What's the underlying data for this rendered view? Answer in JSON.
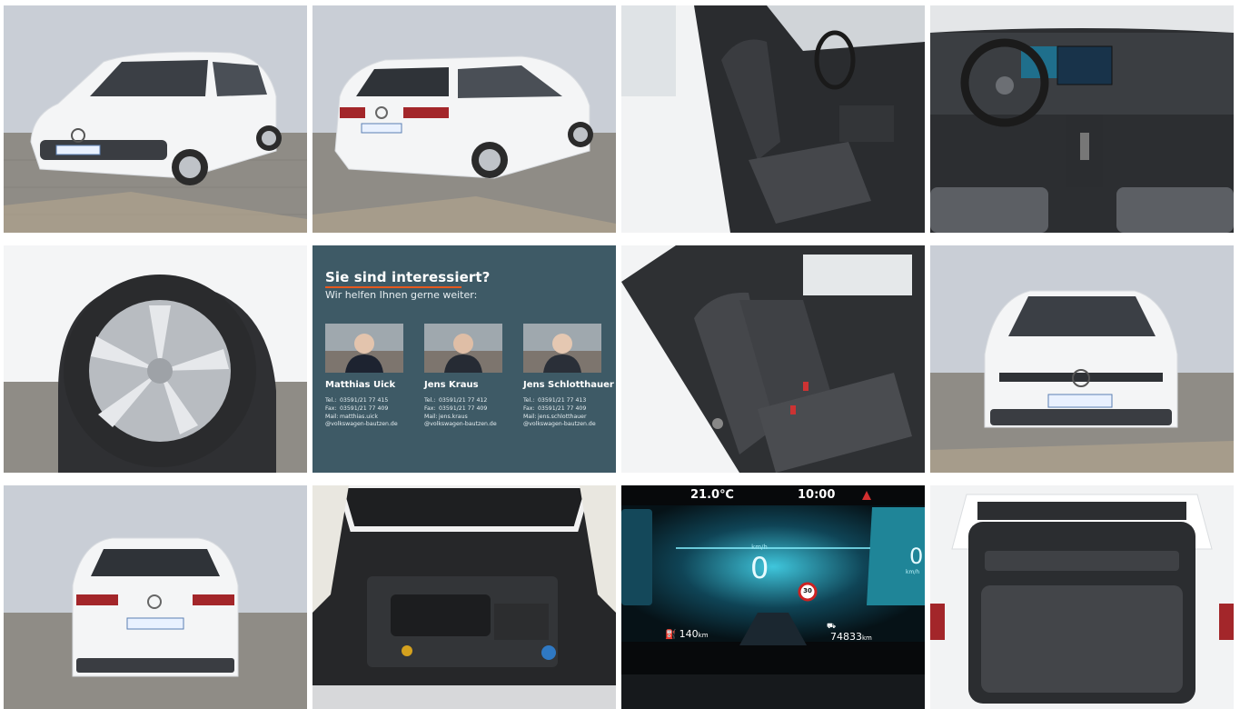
{
  "gallery": {
    "tiles": [
      {
        "id": "front-three-quarter"
      },
      {
        "id": "rear-three-quarter"
      },
      {
        "id": "driver-seat"
      },
      {
        "id": "dashboard-interior"
      },
      {
        "id": "wheel-rim"
      },
      {
        "id": "contact-card"
      },
      {
        "id": "rear-seats"
      },
      {
        "id": "front-view"
      },
      {
        "id": "rear-view"
      },
      {
        "id": "engine-bay"
      },
      {
        "id": "digital-cockpit"
      },
      {
        "id": "trunk"
      }
    ]
  },
  "contact_card": {
    "heading": "Sie sind interessiert?",
    "subheading": "Wir helfen Ihnen gerne weiter:",
    "persons": [
      {
        "name": "Matthias Uick",
        "tel_label": "Tel.:",
        "tel": "03591/21 77 415",
        "fax_label": "Fax:",
        "fax": "03591/21 77 409",
        "mail_label": "Mail:",
        "mail": "matthias.uick",
        "domain": "@volkswagen-bautzen.de"
      },
      {
        "name": "Jens Kraus",
        "tel_label": "Tel.:",
        "tel": "03591/21 77 412",
        "fax_label": "Fax:",
        "fax": "03591/21 77 409",
        "mail_label": "Mail:",
        "mail": "jens.kraus",
        "domain": "@volkswagen-bautzen.de"
      },
      {
        "name": "Jens Schlotthauer",
        "tel_label": "Tel.:",
        "tel": "03591/21 77 413",
        "fax_label": "Fax:",
        "fax": "03591/21 77 409",
        "mail_label": "Mail:",
        "mail": "jens.schlotthauer",
        "domain": "@volkswagen-bautzen.de"
      }
    ]
  },
  "cockpit": {
    "temperature": "21.0℃",
    "time": "10:00",
    "speed": "0",
    "speed_right": "0",
    "speed_unit": "km/h",
    "right_unit": "km/h",
    "speed_limit": "30",
    "range": "140",
    "range_unit": "km",
    "odometer": "74833",
    "odometer_unit": "km"
  },
  "colors": {
    "card_bg": "#3e5a66",
    "accent_orange": "#e8581d",
    "car_white": "#f4f5f6",
    "wall_grey": "#c9ced6",
    "paving": "#8f8c86",
    "cockpit_teal": "#1e9bb0"
  }
}
